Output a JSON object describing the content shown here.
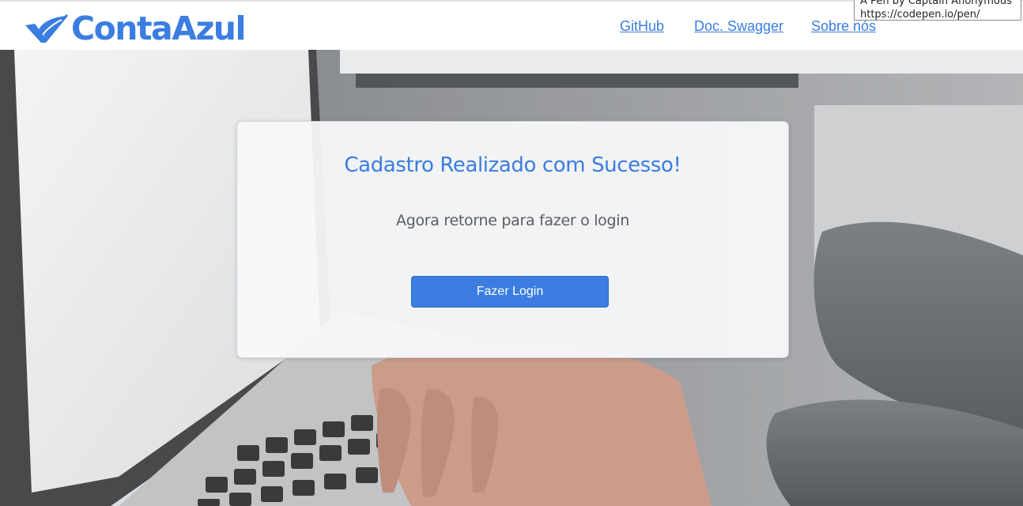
{
  "brand": {
    "name": "ContaAzul",
    "logo_icon": "check-leaf-icon",
    "color": "#3b7de0"
  },
  "nav": {
    "links": [
      {
        "label": "GitHub"
      },
      {
        "label": "Doc. Swagger"
      },
      {
        "label": "Sobre nós"
      }
    ]
  },
  "tooltip": {
    "line1": "A Pen by Captain Anonymous",
    "line2": "https://codepen.io/pen/"
  },
  "card": {
    "title": "Cadastro Realizado com Sucesso!",
    "subtitle": "Agora retorne para fazer o login",
    "button_label": "Fazer Login",
    "accent_color": "#3b7de0"
  }
}
